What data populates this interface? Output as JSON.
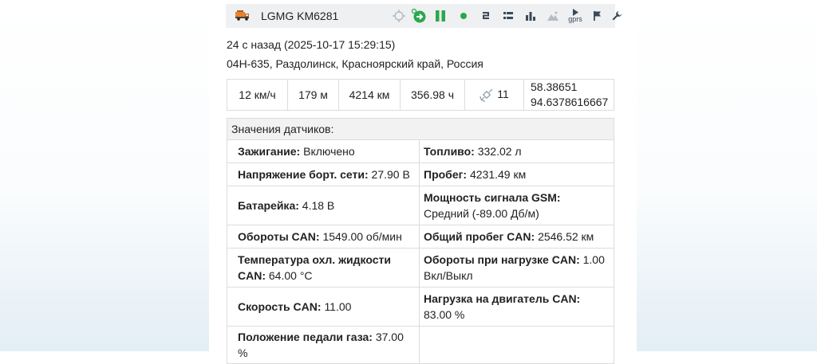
{
  "header": {
    "vehicle_name": "LGMG KM6281",
    "icons": [
      "truck-icon",
      "locate-icon",
      "follow-icon",
      "pause-icon",
      "status-dot-icon",
      "command-icon",
      "list-icon",
      "chart-icon",
      "terrain-icon",
      "gprs-icon",
      "flag-icon",
      "wrench-icon"
    ],
    "gprs_label": "gprs",
    "colors": {
      "accent_green": "#2aa84a",
      "icon_dark": "#3a4a5a",
      "icon_disabled": "#b5bcc4"
    }
  },
  "info": {
    "last_update": "24 с назад (2025-10-17 15:29:15)",
    "address": "04Н-635, Раздолинск, Красноярский край, Россия"
  },
  "stats": {
    "speed": "12 км/ч",
    "altitude": "179 м",
    "distance": "4214 км",
    "hours": "356.98 ч",
    "satellites": "11",
    "lat": "58.38651",
    "lon": "94.6378616667"
  },
  "sensors": {
    "heading": "Значения датчиков:",
    "rows": [
      {
        "l_label": "Зажигание:",
        "l_value": "Включено",
        "r_label": "Топливо:",
        "r_value": "332.02 л"
      },
      {
        "l_label": "Напряжение борт. сети:",
        "l_value": "27.90 В",
        "r_label": "Пробег:",
        "r_value": "4231.49 км"
      },
      {
        "l_label": "Батарейка:",
        "l_value": "4.18 В",
        "r_label": "Мощность сигнала GSM:",
        "r_value": "Средний (-89.00 Дб/м)"
      },
      {
        "l_label": "Обороты CAN:",
        "l_value": "1549.00 об/мин",
        "r_label": "Общий пробег CAN:",
        "r_value": "2546.52 км"
      },
      {
        "l_label": "Температура охл. жидкости CAN:",
        "l_value": "64.00 °C",
        "r_label": "Обороты при нагрузке CAN:",
        "r_value": "1.00 Вкл/Выкл"
      },
      {
        "l_label": "Скорость CAN:",
        "l_value": "11.00",
        "r_label": "Нагрузка на двигатель CAN:",
        "r_value": "83.00 %"
      },
      {
        "l_label": "Положение педали газа:",
        "l_value": "37.00 %",
        "r_label": "",
        "r_value": ""
      }
    ]
  }
}
